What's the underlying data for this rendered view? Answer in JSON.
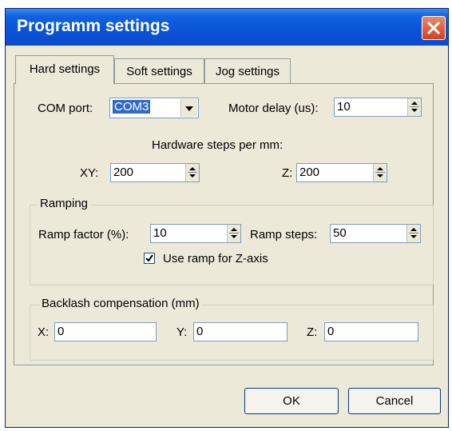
{
  "window": {
    "title": "Programm settings"
  },
  "tabs": [
    {
      "label": "Hard settings",
      "active": true
    },
    {
      "label": "Soft settings",
      "active": false
    },
    {
      "label": "Jog settings",
      "active": false
    }
  ],
  "com_port": {
    "label": "COM port:",
    "value": "COM3"
  },
  "motor_delay": {
    "label": "Motor delay (us):",
    "value": "10"
  },
  "hardware_steps": {
    "heading": "Hardware steps per mm:",
    "xy_label": "XY:",
    "xy_value": "200",
    "z_label": "Z:",
    "z_value": "200"
  },
  "ramping": {
    "group_label": "Ramping",
    "factor_label": "Ramp factor (%):",
    "factor_value": "10",
    "steps_label": "Ramp steps:",
    "steps_value": "50",
    "z_checkbox_label": "Use ramp for Z-axis",
    "z_checkbox_checked": true
  },
  "backlash": {
    "group_label": "Backlash compensation (mm)",
    "x_label": "X:",
    "x_value": "0",
    "y_label": "Y:",
    "y_value": "0",
    "z_label": "Z:",
    "z_value": "0"
  },
  "buttons": {
    "ok": "OK",
    "cancel": "Cancel"
  },
  "colors": {
    "titlebar": "#0a52d6",
    "dialog_bg": "#ece9d8",
    "close_button": "#d1401a",
    "selection": "#316ac5"
  }
}
